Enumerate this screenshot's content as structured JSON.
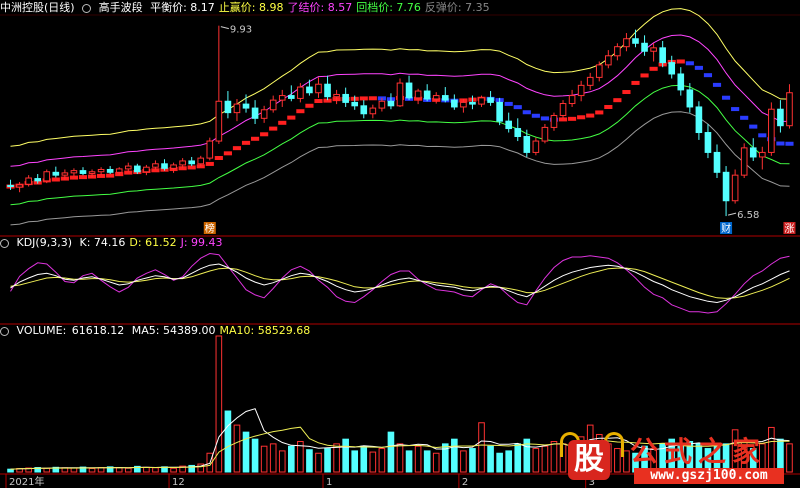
{
  "main_panel": {
    "title": "中洲控股(日线)",
    "indicator": "高手波段",
    "readouts": [
      {
        "label": "平衡价:",
        "value": "8.17",
        "color": "#ffffff"
      },
      {
        "label": "止赢价:",
        "value": "8.98",
        "color": "#ffff44"
      },
      {
        "label": "了结价:",
        "value": "8.57",
        "color": "#ff44ff"
      },
      {
        "label": "回档价:",
        "value": "7.76",
        "color": "#44ff44"
      },
      {
        "label": "反弹价:",
        "value": "7.35",
        "color": "#888888"
      }
    ],
    "high_label": "9.93",
    "low_label": "6.58",
    "markers": [
      "榜",
      "财",
      "涨"
    ]
  },
  "kdj_panel": {
    "name": "KDJ(9,3,3)",
    "readouts": [
      {
        "label": "K:",
        "value": "74.16",
        "color": "#ffffff"
      },
      {
        "label": "D:",
        "value": "61.52",
        "color": "#ffff44"
      },
      {
        "label": "J:",
        "value": "99.43",
        "color": "#ff44ff"
      }
    ]
  },
  "volume_panel": {
    "name": "VOLUME:",
    "value": "61618.12",
    "readouts": [
      {
        "label": "MA5:",
        "value": "54389.00",
        "color": "#ffffff"
      },
      {
        "label": "MA10:",
        "value": "58529.68",
        "color": "#ffff44"
      }
    ]
  },
  "x_axis": {
    "labels": [
      {
        "text": "2021年",
        "index": 0
      },
      {
        "text": "12",
        "index": 18
      },
      {
        "text": "1",
        "index": 35
      },
      {
        "text": "2",
        "index": 50
      },
      {
        "text": "3",
        "index": 64
      }
    ]
  },
  "watermark": {
    "logo_char": "股",
    "title": "公式之家",
    "url": "www.gszj100.com"
  },
  "colors": {
    "up": "#ff3232",
    "down": "#54ffff",
    "band_upper": "#ffff66",
    "band_mid_upper": "#ff44ff",
    "band_mid_lower": "#44ff44",
    "band_lower": "#999999",
    "axis": "#b00000"
  },
  "chart_data": {
    "type": "candlestick",
    "price_range": [
      6.3,
      10.1
    ],
    "ohlc": [
      [
        7.12,
        7.22,
        7.04,
        7.1
      ],
      [
        7.09,
        7.18,
        7.0,
        7.13
      ],
      [
        7.14,
        7.3,
        7.1,
        7.25
      ],
      [
        7.24,
        7.32,
        7.15,
        7.2
      ],
      [
        7.2,
        7.4,
        7.16,
        7.36
      ],
      [
        7.35,
        7.45,
        7.26,
        7.3
      ],
      [
        7.3,
        7.4,
        7.22,
        7.34
      ],
      [
        7.34,
        7.42,
        7.28,
        7.38
      ],
      [
        7.38,
        7.44,
        7.3,
        7.33
      ],
      [
        7.33,
        7.4,
        7.26,
        7.36
      ],
      [
        7.36,
        7.44,
        7.3,
        7.4
      ],
      [
        7.4,
        7.46,
        7.32,
        7.35
      ],
      [
        7.35,
        7.44,
        7.3,
        7.41
      ],
      [
        7.41,
        7.52,
        7.36,
        7.46
      ],
      [
        7.46,
        7.5,
        7.32,
        7.36
      ],
      [
        7.36,
        7.48,
        7.3,
        7.44
      ],
      [
        7.44,
        7.56,
        7.4,
        7.5
      ],
      [
        7.5,
        7.58,
        7.38,
        7.42
      ],
      [
        7.42,
        7.52,
        7.34,
        7.48
      ],
      [
        7.48,
        7.6,
        7.42,
        7.55
      ],
      [
        7.55,
        7.62,
        7.46,
        7.5
      ],
      [
        7.5,
        7.64,
        7.45,
        7.6
      ],
      [
        7.6,
        7.96,
        7.56,
        7.9
      ],
      [
        7.9,
        9.93,
        7.85,
        8.6
      ],
      [
        8.6,
        8.78,
        8.3,
        8.4
      ],
      [
        8.4,
        8.64,
        8.25,
        8.55
      ],
      [
        8.55,
        8.72,
        8.4,
        8.48
      ],
      [
        8.48,
        8.62,
        8.2,
        8.3
      ],
      [
        8.3,
        8.52,
        8.22,
        8.45
      ],
      [
        8.45,
        8.7,
        8.4,
        8.62
      ],
      [
        8.62,
        8.8,
        8.5,
        8.7
      ],
      [
        8.7,
        8.88,
        8.6,
        8.65
      ],
      [
        8.65,
        8.92,
        8.58,
        8.85
      ],
      [
        8.85,
        8.98,
        8.7,
        8.75
      ],
      [
        8.75,
        9.02,
        8.66,
        8.9
      ],
      [
        8.9,
        9.05,
        8.62,
        8.68
      ],
      [
        8.68,
        8.8,
        8.55,
        8.72
      ],
      [
        8.72,
        8.84,
        8.5,
        8.58
      ],
      [
        8.58,
        8.7,
        8.45,
        8.52
      ],
      [
        8.52,
        8.62,
        8.3,
        8.38
      ],
      [
        8.38,
        8.54,
        8.3,
        8.48
      ],
      [
        8.48,
        8.66,
        8.42,
        8.6
      ],
      [
        8.6,
        8.74,
        8.46,
        8.52
      ],
      [
        8.52,
        9.0,
        8.5,
        8.92
      ],
      [
        8.92,
        9.05,
        8.62,
        8.66
      ],
      [
        8.66,
        8.82,
        8.55,
        8.78
      ],
      [
        8.78,
        8.9,
        8.6,
        8.64
      ],
      [
        8.64,
        8.76,
        8.56,
        8.7
      ],
      [
        8.7,
        8.85,
        8.58,
        8.62
      ],
      [
        8.62,
        8.72,
        8.45,
        8.5
      ],
      [
        8.5,
        8.64,
        8.4,
        8.58
      ],
      [
        8.58,
        8.7,
        8.46,
        8.55
      ],
      [
        8.55,
        8.7,
        8.5,
        8.66
      ],
      [
        8.66,
        8.78,
        8.52,
        8.58
      ],
      [
        8.58,
        8.66,
        8.18,
        8.25
      ],
      [
        8.25,
        8.4,
        8.05,
        8.12
      ],
      [
        8.12,
        8.3,
        7.9,
        7.98
      ],
      [
        7.98,
        8.1,
        7.62,
        7.7
      ],
      [
        7.7,
        7.96,
        7.65,
        7.9
      ],
      [
        7.9,
        8.2,
        7.86,
        8.14
      ],
      [
        8.14,
        8.4,
        8.08,
        8.35
      ],
      [
        8.35,
        8.62,
        8.3,
        8.56
      ],
      [
        8.56,
        8.8,
        8.5,
        8.7
      ],
      [
        8.7,
        8.96,
        8.6,
        8.88
      ],
      [
        8.88,
        9.1,
        8.8,
        9.02
      ],
      [
        9.02,
        9.3,
        8.95,
        9.24
      ],
      [
        9.24,
        9.5,
        9.18,
        9.4
      ],
      [
        9.4,
        9.62,
        9.32,
        9.56
      ],
      [
        9.56,
        9.8,
        9.48,
        9.7
      ],
      [
        9.7,
        9.86,
        9.55,
        9.62
      ],
      [
        9.62,
        9.76,
        9.4,
        9.48
      ],
      [
        9.48,
        9.62,
        9.3,
        9.54
      ],
      [
        9.54,
        9.66,
        9.2,
        9.28
      ],
      [
        9.28,
        9.4,
        9.0,
        9.08
      ],
      [
        9.08,
        9.2,
        8.7,
        8.8
      ],
      [
        8.8,
        8.92,
        8.4,
        8.5
      ],
      [
        8.5,
        8.6,
        7.92,
        8.05
      ],
      [
        8.05,
        8.2,
        7.6,
        7.7
      ],
      [
        7.7,
        7.84,
        7.25,
        7.35
      ],
      [
        7.35,
        7.46,
        6.58,
        6.85
      ],
      [
        6.85,
        7.4,
        6.8,
        7.3
      ],
      [
        7.3,
        7.86,
        7.25,
        7.78
      ],
      [
        7.78,
        7.95,
        7.55,
        7.62
      ],
      [
        7.62,
        7.8,
        7.4,
        7.7
      ],
      [
        7.7,
        8.58,
        7.64,
        8.46
      ],
      [
        8.46,
        8.62,
        8.05,
        8.17
      ],
      [
        8.17,
        8.9,
        8.12,
        8.75
      ]
    ],
    "volume": [
      1200,
      1500,
      1700,
      1900,
      1600,
      2000,
      1800,
      1700,
      2100,
      1500,
      1900,
      2200,
      1800,
      1600,
      2400,
      2000,
      1800,
      2200,
      1600,
      2500,
      2800,
      3400,
      8000,
      58000,
      26000,
      20000,
      17000,
      14000,
      11000,
      12000,
      9000,
      11000,
      13000,
      9500,
      8000,
      10000,
      12000,
      14000,
      9000,
      11000,
      8500,
      10000,
      17000,
      12000,
      9000,
      11000,
      9000,
      8000,
      12000,
      14000,
      9000,
      10000,
      21000,
      11000,
      8000,
      9000,
      12000,
      14000,
      10000,
      11000,
      13000,
      12000,
      9000,
      15000,
      20000,
      16000,
      12000,
      10000,
      9000,
      8000,
      11000,
      10000,
      12000,
      14000,
      11000,
      13000,
      12000,
      10000,
      11000,
      12000,
      18000,
      13000,
      10000,
      12000,
      19000,
      14000,
      12000
    ],
    "kdj": {
      "K": [
        45,
        55,
        62,
        68,
        70,
        66,
        60,
        58,
        62,
        64,
        60,
        55,
        50,
        52,
        58,
        62,
        66,
        64,
        60,
        62,
        70,
        78,
        84,
        86,
        80,
        72,
        62,
        55,
        50,
        54,
        60,
        66,
        70,
        68,
        62,
        56,
        48,
        42,
        38,
        40,
        44,
        50,
        56,
        60,
        62,
        58,
        54,
        50,
        48,
        46,
        42,
        40,
        44,
        48,
        46,
        40,
        34,
        30,
        38,
        48,
        58,
        66,
        72,
        76,
        80,
        82,
        84,
        82,
        78,
        72,
        64,
        56,
        50,
        42,
        36,
        30,
        26,
        22,
        20,
        24,
        30,
        38,
        46,
        52,
        60,
        68,
        74.16
      ],
      "D": [
        48,
        50,
        54,
        58,
        62,
        63,
        62,
        60,
        60,
        61,
        61,
        59,
        56,
        55,
        56,
        58,
        61,
        62,
        61,
        61,
        64,
        69,
        74,
        78,
        79,
        77,
        72,
        66,
        61,
        59,
        59,
        61,
        64,
        65,
        64,
        61,
        57,
        52,
        47,
        45,
        45,
        47,
        50,
        53,
        56,
        57,
        56,
        54,
        52,
        50,
        47,
        45,
        45,
        46,
        46,
        44,
        41,
        37,
        37,
        41,
        47,
        53,
        59,
        65,
        70,
        74,
        78,
        79,
        79,
        77,
        73,
        67,
        61,
        55,
        49,
        43,
        37,
        32,
        28,
        27,
        28,
        31,
        36,
        41,
        47,
        54,
        61.52
      ],
      "J": [
        39,
        65,
        78,
        88,
        86,
        72,
        56,
        54,
        66,
        70,
        58,
        47,
        38,
        46,
        62,
        70,
        76,
        68,
        58,
        64,
        82,
        96,
        104,
        102,
        82,
        62,
        42,
        33,
        28,
        44,
        62,
        76,
        82,
        74,
        58,
        46,
        30,
        22,
        20,
        30,
        42,
        56,
        68,
        74,
        74,
        60,
        50,
        42,
        40,
        38,
        32,
        30,
        42,
        52,
        46,
        32,
        20,
        16,
        40,
        62,
        80,
        92,
        98,
        98,
        100,
        98,
        96,
        88,
        76,
        62,
        46,
        34,
        28,
        16,
        10,
        4,
        4,
        2,
        4,
        18,
        34,
        52,
        66,
        74,
        86,
        96,
        99.43
      ]
    }
  }
}
